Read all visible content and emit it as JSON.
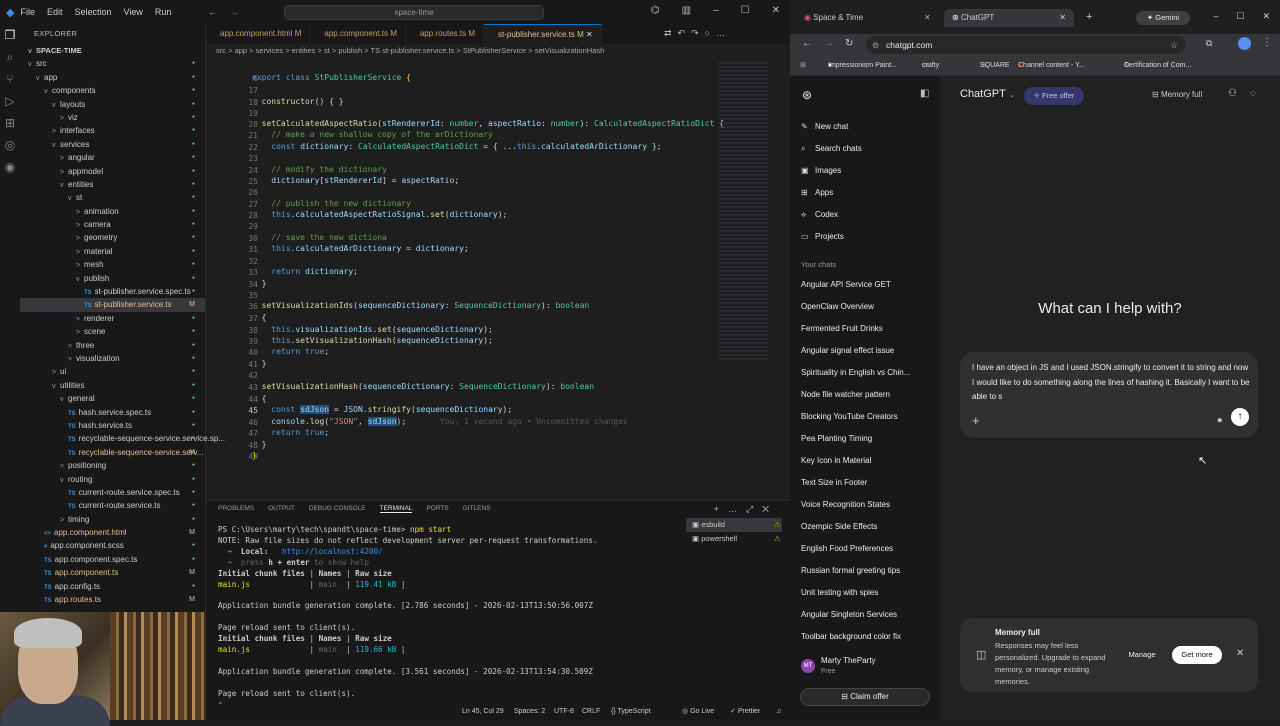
{
  "vscode": {
    "menu": [
      "File",
      "Edit",
      "Selection",
      "View",
      "Run"
    ],
    "command_center": "space-time",
    "explorer_title": "EXPLORER",
    "project": "SPACE-TIME",
    "tree": [
      {
        "label": "src",
        "chev": "v",
        "indent": 0
      },
      {
        "label": "app",
        "chev": "v",
        "indent": 1
      },
      {
        "label": "components",
        "chev": "v",
        "indent": 2
      },
      {
        "label": "layouts",
        "chev": "v",
        "indent": 3
      },
      {
        "label": "viz",
        "chev": ">",
        "indent": 4
      },
      {
        "label": "interfaces",
        "chev": ">",
        "indent": 3
      },
      {
        "label": "services",
        "chev": "v",
        "indent": 3
      },
      {
        "label": "angular",
        "chev": ">",
        "indent": 4
      },
      {
        "label": "appmodel",
        "chev": ">",
        "indent": 4
      },
      {
        "label": "entities",
        "chev": "v",
        "indent": 4
      },
      {
        "label": "st",
        "chev": "v",
        "indent": 5
      },
      {
        "label": "animation",
        "chev": ">",
        "indent": 6
      },
      {
        "label": "camera",
        "chev": ">",
        "indent": 6
      },
      {
        "label": "geometry",
        "chev": ">",
        "indent": 6
      },
      {
        "label": "material",
        "chev": ">",
        "indent": 6
      },
      {
        "label": "mesh",
        "chev": ">",
        "indent": 6
      },
      {
        "label": "publish",
        "chev": "v",
        "indent": 6
      },
      {
        "label": "st-publisher.service.spec.ts",
        "ts": "TS",
        "indent": 7
      },
      {
        "label": "st-publisher.service.ts",
        "ts": "TS",
        "indent": 7,
        "mark": "M",
        "sel": true
      },
      {
        "label": "renderer",
        "chev": ">",
        "indent": 6
      },
      {
        "label": "scene",
        "chev": ">",
        "indent": 6
      },
      {
        "label": "three",
        "chev": ">",
        "indent": 5
      },
      {
        "label": "visualization",
        "chev": ">",
        "indent": 5
      },
      {
        "label": "ui",
        "chev": ">",
        "indent": 3
      },
      {
        "label": "utilities",
        "chev": "v",
        "indent": 3
      },
      {
        "label": "general",
        "chev": "v",
        "indent": 4
      },
      {
        "label": "hash.service.spec.ts",
        "ts": "TS",
        "indent": 5
      },
      {
        "label": "hash.service.ts",
        "ts": "TS",
        "indent": 5
      },
      {
        "label": "recyclable-sequence-service.service.sp...",
        "ts": "TS",
        "indent": 5
      },
      {
        "label": "recyclable-sequence-service.serv...",
        "ts": "TS",
        "indent": 5,
        "mark": "M"
      },
      {
        "label": "positioning",
        "chev": ">",
        "indent": 4
      },
      {
        "label": "routing",
        "chev": "v",
        "indent": 4
      },
      {
        "label": "current-route.service.spec.ts",
        "ts": "TS",
        "indent": 5
      },
      {
        "label": "current-route.service.ts",
        "ts": "TS",
        "indent": 5
      },
      {
        "label": "timing",
        "chev": ">",
        "indent": 4
      },
      {
        "label": "app.component.html",
        "ts": "<>",
        "indent": 2,
        "mark": "M"
      },
      {
        "label": "app.component.scss",
        "ts": "#",
        "indent": 2
      },
      {
        "label": "app.component.spec.ts",
        "ts": "TS",
        "indent": 2
      },
      {
        "label": "app.component.ts",
        "ts": "TS",
        "indent": 2,
        "mark": "M"
      },
      {
        "label": "app.config.ts",
        "ts": "TS",
        "indent": 2
      },
      {
        "label": "app.routes.ts",
        "ts": "TS",
        "indent": 2,
        "mark": "M"
      }
    ],
    "tabs": [
      {
        "label": "app.component.html M",
        "active": false
      },
      {
        "label": "app.component.ts M",
        "active": false
      },
      {
        "label": "app.routes.ts M",
        "active": false
      },
      {
        "label": "st-publisher.service.ts M",
        "active": true
      }
    ],
    "breadcrumb": "src > app > services > entities > st > publish > TS st-publisher.service.ts > StPublisherService > setVisualizationHash",
    "line_numbers": [
      "6",
      "17",
      "18",
      "19",
      "20",
      "21",
      "22",
      "23",
      "24",
      "25",
      "26",
      "27",
      "28",
      "29",
      "30",
      "31",
      "32",
      "33",
      "34",
      "35",
      "36",
      "37",
      "38",
      "39",
      "40",
      "41",
      "42",
      "43",
      "44",
      "45",
      "46",
      "47",
      "48",
      "49"
    ],
    "panel_tabs": [
      "PROBLEMS",
      "OUTPUT",
      "DEBUG CONSOLE",
      "TERMINAL",
      "PORTS",
      "GITLENS"
    ],
    "terminal_sessions": [
      "esbuild",
      "powershell"
    ],
    "status": {
      "position": "Ln 45, Col 29",
      "spaces": "Spaces: 2",
      "encoding": "UTF-8",
      "eol": "CRLF",
      "language": "TypeScript",
      "golive": "Go Live",
      "prettier": "Prettier"
    }
  },
  "chrome": {
    "tabs": [
      {
        "label": "Space & Time"
      },
      {
        "label": "ChatGPT"
      },
      {
        "label": "Gemini"
      }
    ],
    "url": "chatgpt.com",
    "bookmarks": [
      "Impressionism Paint...",
      "crafty",
      "SQUARE",
      "Channel content - Y...",
      "Certification of Com..."
    ]
  },
  "chatgpt": {
    "model": "ChatGPT",
    "free_offer": "Free offer",
    "memory": "Memory full",
    "nav": [
      {
        "icon": "✎",
        "label": "New chat"
      },
      {
        "icon": "⌕",
        "label": "Search chats"
      },
      {
        "icon": "▣",
        "label": "Images"
      },
      {
        "icon": "⊞",
        "label": "Apps"
      },
      {
        "icon": "⟡",
        "label": "Codex"
      },
      {
        "icon": "▭",
        "label": "Projects"
      }
    ],
    "chats_heading": "Your chats",
    "chats": [
      "Angular API Service GET",
      "OpenClaw Overview",
      "Fermented Fruit Drinks",
      "Angular signal effect issue",
      "Spirituality in English vs Chin...",
      "Node file watcher pattern",
      "Blocking YouTube Creators",
      "Pea Planting Timing",
      "Key Icon in Material",
      "Text Size in Footer",
      "Voice Recognition States",
      "Ozempic Side Effects",
      "English Food Preferences",
      "Russian formal greeting tips",
      "Unit testing with spies",
      "Angular Singleton Services",
      "Toolbar background color fix"
    ],
    "user": {
      "initials": "MT",
      "name": "Marty TheParty",
      "plan": "Free"
    },
    "claim_offer": "Claim offer",
    "heading": "What can I help with?",
    "composer_text": "I have an object in JS and I used JSON.stringify to convert it to string and now I would like to do something along the lines of hashing it.  Basically I want to be able to s",
    "toast": {
      "title": "Memory full",
      "body": "Responses may feel less personalized. Upgrade to expand memory, or manage existing memories.",
      "manage": "Manage",
      "get_more": "Get more"
    }
  }
}
